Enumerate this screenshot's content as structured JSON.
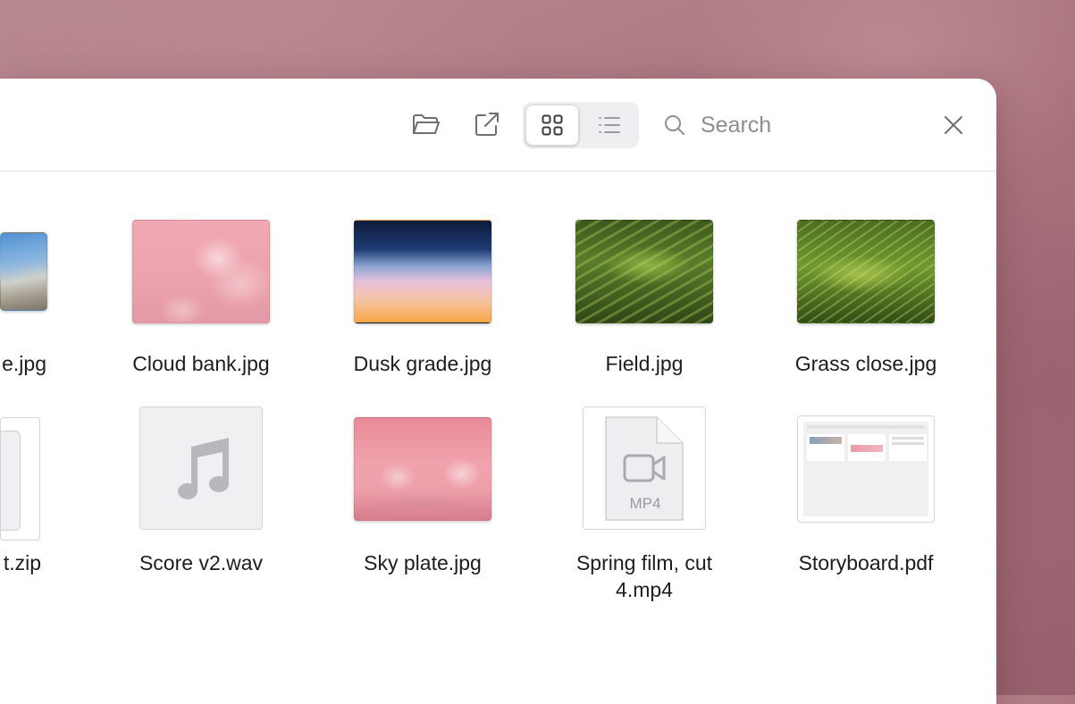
{
  "toolbar": {
    "open_folder_icon": "folder-open-icon",
    "share_icon": "share-icon",
    "view_grid_icon": "grid-view-icon",
    "view_list_icon": "list-view-icon",
    "search_placeholder": "Search",
    "close_icon": "close-icon"
  },
  "files": [
    {
      "name": "e.jpg"
    },
    {
      "name": "Cloud bank.jpg"
    },
    {
      "name": "Dusk grade.jpg"
    },
    {
      "name": "Field.jpg"
    },
    {
      "name": "Grass close.jpg"
    },
    {
      "name": "t.zip"
    },
    {
      "name": "Score v2.wav"
    },
    {
      "name": "Sky plate.jpg"
    },
    {
      "name": "Spring film, cut",
      "name2": "4.mp4",
      "badge": "MP4"
    },
    {
      "name": "Storyboard.pdf"
    }
  ],
  "colors": {
    "accent": "#ffffff",
    "text": "#1d1d1f",
    "icon": "#6e6e73"
  }
}
